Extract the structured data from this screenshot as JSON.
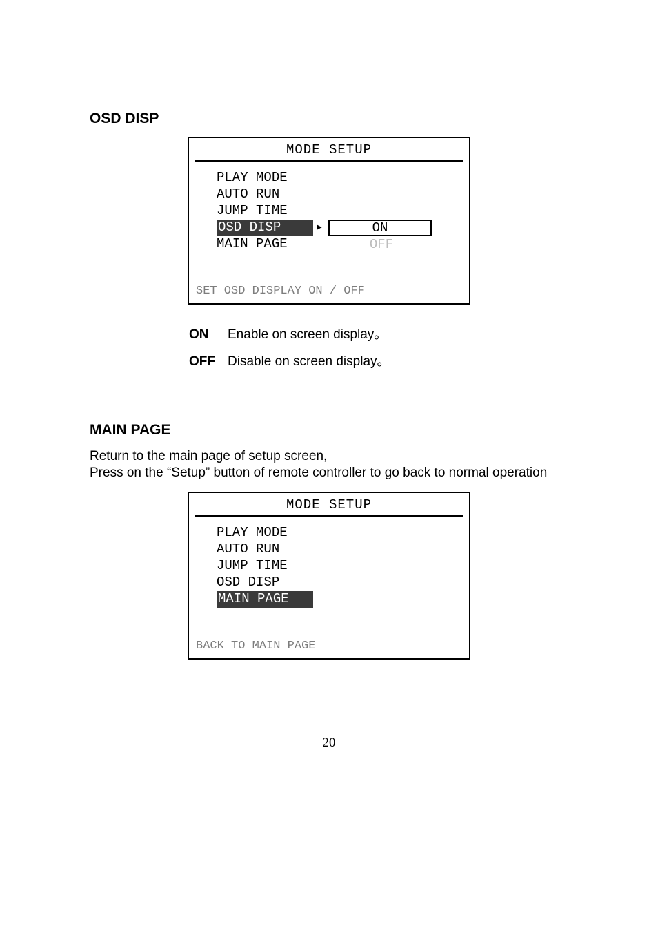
{
  "section1": {
    "heading": "OSD DISP",
    "panel": {
      "title": "MODE SETUP",
      "items": [
        {
          "label": "PLAY MODE",
          "selected": false
        },
        {
          "label": "AUTO RUN",
          "selected": false
        },
        {
          "label": "JUMP TIME",
          "selected": false
        },
        {
          "label": "OSD DISP",
          "selected": true,
          "arrow": "▸",
          "option_boxed": "ON"
        },
        {
          "label": "MAIN PAGE",
          "selected": false,
          "option_dim": "OFF"
        }
      ],
      "hint": "SET OSD DISPLAY ON / OFF"
    },
    "defs": [
      {
        "key": "ON",
        "text": "Enable on screen display。"
      },
      {
        "key": "OFF",
        "text": "Disable on screen display。"
      }
    ]
  },
  "section2": {
    "heading": "MAIN PAGE",
    "body_line1": "Return to the main page of setup screen,",
    "body_line2": "Press on the “Setup” button of remote controller to go back to normal operation",
    "panel": {
      "title": "MODE SETUP",
      "items": [
        {
          "label": "PLAY MODE",
          "selected": false
        },
        {
          "label": "AUTO RUN",
          "selected": false
        },
        {
          "label": "JUMP TIME",
          "selected": false
        },
        {
          "label": "OSD DISP",
          "selected": false
        },
        {
          "label": "MAIN PAGE",
          "selected": true
        }
      ],
      "hint": "BACK TO MAIN PAGE"
    }
  },
  "page_number": "20"
}
